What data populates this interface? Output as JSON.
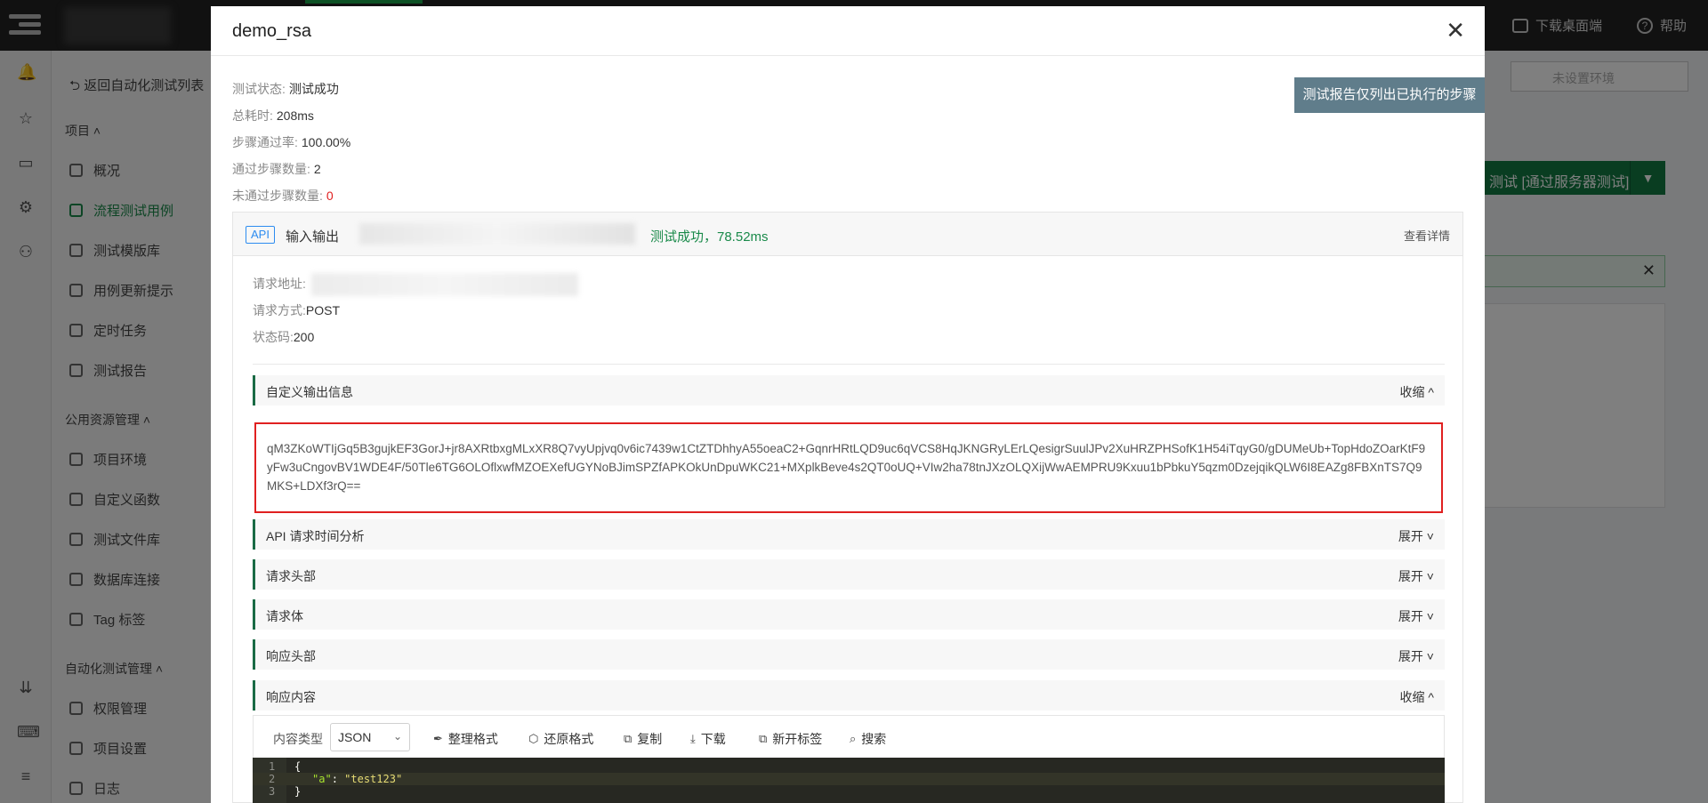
{
  "top_nav": {
    "download_label": "下载桌面端",
    "help_label": "帮助"
  },
  "sidebar": {
    "back_label": "返回自动化测试列表",
    "section_project": "项目 ˄",
    "project_items": [
      "概况",
      "流程测试用例",
      "测试模版库",
      "用例更新提示",
      "定时任务",
      "测试报告"
    ],
    "section_public": "公用资源管理 ˄",
    "public_items": [
      "项目环境",
      "自定义函数",
      "测试文件库",
      "数据库连接",
      "Tag 标签"
    ],
    "section_auto": "自动化测试管理 ˄",
    "auto_items": [
      "权限管理",
      "项目设置",
      "日志"
    ]
  },
  "background": {
    "env_placeholder": "未设置环境",
    "run_button": "测试 [通过服务器测试]"
  },
  "modal": {
    "title": "demo_rsa",
    "summary": [
      {
        "label": "测试状态:",
        "value": "测试成功"
      },
      {
        "label": "总耗时:",
        "value": "208ms"
      },
      {
        "label": "步骤通过率:",
        "value": "100.00%"
      },
      {
        "label": "通过步骤数量:",
        "value": "2"
      },
      {
        "label": "未通过步骤数量:",
        "value": "0"
      }
    ],
    "tip_button": "测试报告仅列出已执行的步骤",
    "api": {
      "badge": "API",
      "name": "输入输出",
      "status": "测试成功，78.52ms",
      "detail_link": "查看详情",
      "request_url_label": "请求地址:",
      "request_method_label": "请求方式:",
      "request_method": "POST",
      "status_code_label": "状态码:",
      "status_code": "200",
      "sections": [
        {
          "title": "自定义输出信息",
          "action": "收缩 ^"
        },
        {
          "title": "API 请求时间分析",
          "action": "展开 ˅"
        },
        {
          "title": "请求头部",
          "action": "展开 ˅"
        },
        {
          "title": "请求体",
          "action": "展开 ˅"
        },
        {
          "title": "响应头部",
          "action": "展开 ˅"
        },
        {
          "title": "响应内容",
          "action": "收缩 ^"
        }
      ],
      "custom_output": "qM3ZKoWTIjGq5B3gujkEF3GorJ+jr8AXRtbxgMLxXR8Q7vyUpjvq0v6ic7439w1CtZTDhhyA55oeaC2+GqnrHRtLQD9uc6qVCS8HqJKNGRyLErLQesigrSuulJPv2XuHRZPHSofK1H54iTqyG0/gDUMeUb+TopHdoZOarKtF9yFw3uCngovBV1WDE4F/50Tle6TG6OLOflxwfMZOEXefUGYNoBJimSPZfAPKOkUnDpuWKC21+MXplkBeve4s2QT0oUQ+VIw2ha78tnJXzOLQXijWwAEMPRU9Kxuu1bPbkuY5qzm0DzejqikQLW6I8EAZg8FBXnTS7Q9MKS+LDXf3rQ==",
      "toolbar": {
        "content_type_label": "内容类型",
        "content_type_value": "JSON",
        "format_label": "整理格式",
        "restore_label": "还原格式",
        "copy_label": "复制",
        "download_label": "下载",
        "new_tab_label": "新开标签",
        "search_label": "搜索"
      },
      "code_lines": [
        {
          "n": "1",
          "text": "{"
        },
        {
          "n": "2",
          "key": "\"a\"",
          "sep": ": ",
          "value": "\"test123\""
        },
        {
          "n": "3",
          "text": "}"
        }
      ]
    }
  }
}
